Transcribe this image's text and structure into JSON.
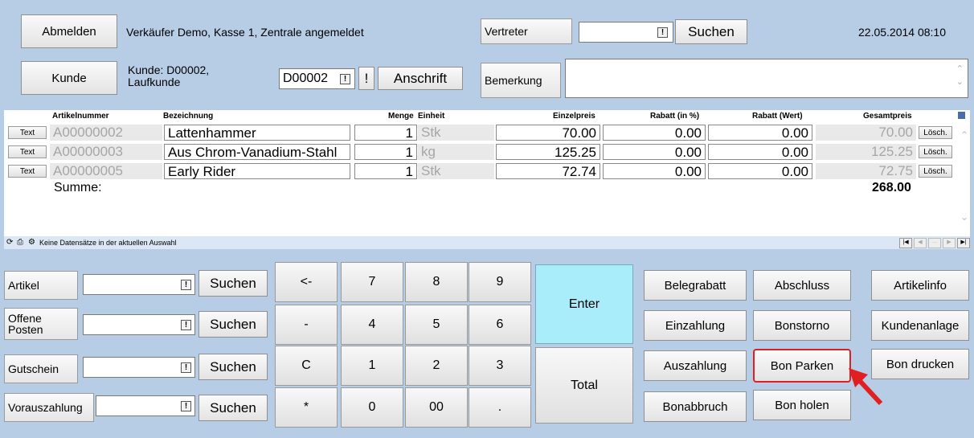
{
  "header": {
    "logout_label": "Abmelden",
    "login_status": "Verkäufer Demo, Kasse 1, Zentrale angemeldet",
    "vertreter_label": "Vertreter",
    "vertreter_value": "",
    "vertreter_search_label": "Suchen",
    "datetime": "22.05.2014 08:10",
    "customer_button_label": "Kunde",
    "customer_info_line1": "Kunde: D00002,",
    "customer_info_line2": "Laufkunde",
    "customer_code": "D00002",
    "alert_label": "!",
    "address_label": "Anschrift",
    "remark_label": "Bemerkung",
    "remark_value": ""
  },
  "table": {
    "columns": [
      "Artikelnummer",
      "Bezeichnung",
      "Menge",
      "Einheit",
      "Einzelpreis",
      "Rabatt (in %)",
      "Rabatt (Wert)",
      "Gesamtpreis"
    ],
    "rows": [
      {
        "text_btn": "Text",
        "artnr": "A00000002",
        "bez": "Lattenhammer",
        "menge": "1",
        "einheit": "Stk",
        "preis": "70.00",
        "rabatt_pct": "0.00",
        "rabatt_wert": "0.00",
        "gesamt": "70.00",
        "del": "Lösch."
      },
      {
        "text_btn": "Text",
        "artnr": "A00000003",
        "bez": "Aus Chrom-Vanadium-Stahl",
        "menge": "1",
        "einheit": "kg",
        "preis": "125.25",
        "rabatt_pct": "0.00",
        "rabatt_wert": "0.00",
        "gesamt": "125.25",
        "del": "Lösch."
      },
      {
        "text_btn": "Text",
        "artnr": "A00000005",
        "bez": "Early Rider",
        "menge": "1",
        "einheit": "Stk",
        "preis": "72.74",
        "rabatt_pct": "0.00",
        "rabatt_wert": "0.00",
        "gesamt": "72.75",
        "del": "Lösch."
      }
    ],
    "sum_label": "Summe:",
    "sum_value": "268.00"
  },
  "navbar": {
    "status_text": "Keine Datensätze in der aktuellen Auswahl",
    "ellipsis": "..."
  },
  "lookups": [
    {
      "label": "Artikel",
      "value": "",
      "search": "Suchen"
    },
    {
      "label": "Offene Posten",
      "value": "",
      "search": "Suchen"
    },
    {
      "label": "Gutschein",
      "value": "",
      "search": "Suchen"
    },
    {
      "label": "Vorauszahlung",
      "value": "",
      "search": "Suchen"
    }
  ],
  "keypad": {
    "backspace": "<-",
    "k7": "7",
    "k8": "8",
    "k9": "9",
    "minus": "-",
    "k4": "4",
    "k5": "5",
    "k6": "6",
    "clear": "C",
    "k1": "1",
    "k2": "2",
    "k3": "3",
    "star": "*",
    "k0": "0",
    "k00": "00",
    "dot": ".",
    "enter": "Enter",
    "total": "Total"
  },
  "actions": {
    "belegrabatt": "Belegrabatt",
    "abschluss": "Abschluss",
    "artikelinfo": "Artikelinfo",
    "einzahlung": "Einzahlung",
    "bonstorno": "Bonstorno",
    "kundenanlage": "Kundenanlage",
    "auszahlung": "Auszahlung",
    "bon_parken": "Bon Parken",
    "bon_drucken": "Bon drucken",
    "bonabbruch": "Bonabbruch",
    "bon_holen": "Bon holen"
  },
  "colors": {
    "background": "#b7cde6",
    "enter_key": "#a9ecfa",
    "highlight": "#e02020"
  }
}
